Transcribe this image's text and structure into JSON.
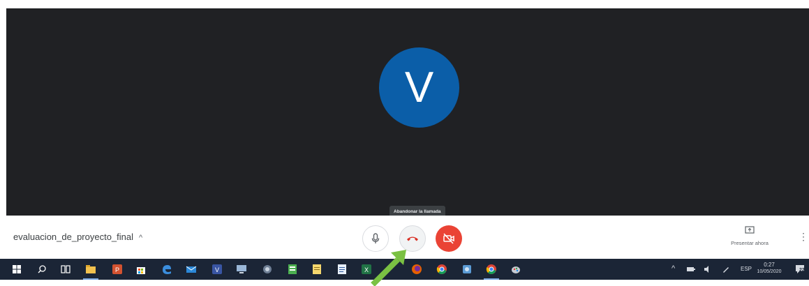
{
  "participant": {
    "initial": "V",
    "color": "#0b5ea8"
  },
  "tooltip": {
    "text": "Abandonar la llamada"
  },
  "meeting": {
    "title": "evaluacion_de_proyecto_final"
  },
  "controls": {
    "present_label": "Presentar ahora"
  },
  "taskbar": {
    "icons": [
      "windows-start-icon",
      "search-icon",
      "task-view-icon",
      "file-explorer-icon",
      "powerpoint-icon",
      "store-icon",
      "edge-icon",
      "mail-icon",
      "visio-icon",
      "remote-desktop-icon",
      "network-icon",
      "project-icon",
      "notepad-icon",
      "word-doc-icon",
      "excel-icon",
      "firefox-icon",
      "chrome-icon",
      "photos-icon",
      "chrome-icon-2",
      "paint-icon"
    ],
    "tray": {
      "language": "ESP",
      "time": "0:27",
      "date": "10/05/2020",
      "notifications": "22"
    }
  },
  "colors": {
    "stage_bg": "#202124",
    "hangup_red": "#ea4335",
    "taskbar_bg": "#1b2536",
    "annotation_green": "#7ac143"
  }
}
